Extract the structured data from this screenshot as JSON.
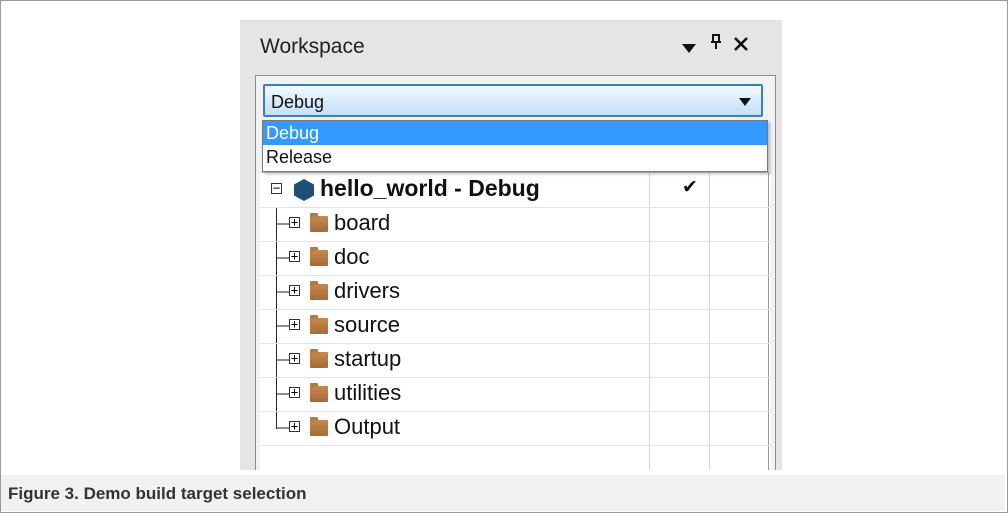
{
  "workspace": {
    "title": "Workspace",
    "icons": [
      "dropdown-arrow-icon",
      "pin-icon",
      "close-icon"
    ],
    "close_glyph": "✕",
    "pin_glyph": "ᵖ"
  },
  "config_select": {
    "value": "Debug",
    "options": [
      "Debug",
      "Release"
    ],
    "selected_index": 0,
    "highlight_color": "#3399ff"
  },
  "tree": {
    "root": {
      "label": "hello_world - Debug",
      "check": "✔"
    },
    "children": [
      {
        "label": "board"
      },
      {
        "label": "doc"
      },
      {
        "label": "drivers"
      },
      {
        "label": "source"
      },
      {
        "label": "startup"
      },
      {
        "label": "utilities"
      },
      {
        "label": "Output"
      }
    ]
  },
  "caption": "Figure 3.  Demo build target selection"
}
